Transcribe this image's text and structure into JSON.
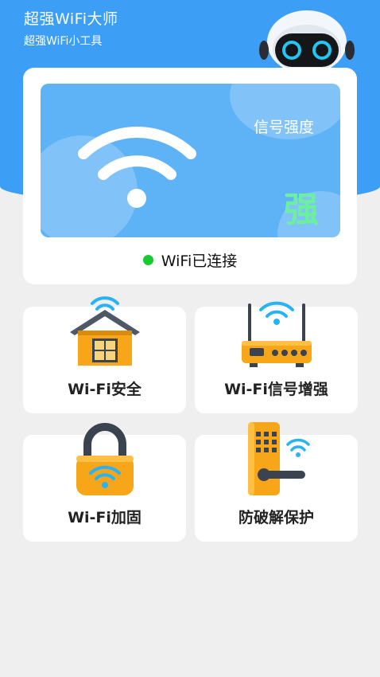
{
  "header": {
    "title": "超强WiFi大师",
    "subtitle": "超强WiFi小工具",
    "mascot_icon": "robot-mascot-icon"
  },
  "signal_card": {
    "strength_title": "信号强度",
    "strength_value": "强",
    "status_text": "WiFi已连接",
    "status_color": "#18c930"
  },
  "tiles": [
    {
      "label": "Wi-Fi安全",
      "icon": "house-wifi-icon"
    },
    {
      "label": "Wi-Fi信号增强",
      "icon": "router-icon"
    },
    {
      "label": "Wi-Fi加固",
      "icon": "padlock-icon"
    },
    {
      "label": "防破解保护",
      "icon": "door-lock-icon"
    }
  ],
  "colors": {
    "primary": "#3d9ef5",
    "panel": "#5eb2f6",
    "accent_orange": "#f7a619",
    "strength_green": "#6cf0a0"
  }
}
